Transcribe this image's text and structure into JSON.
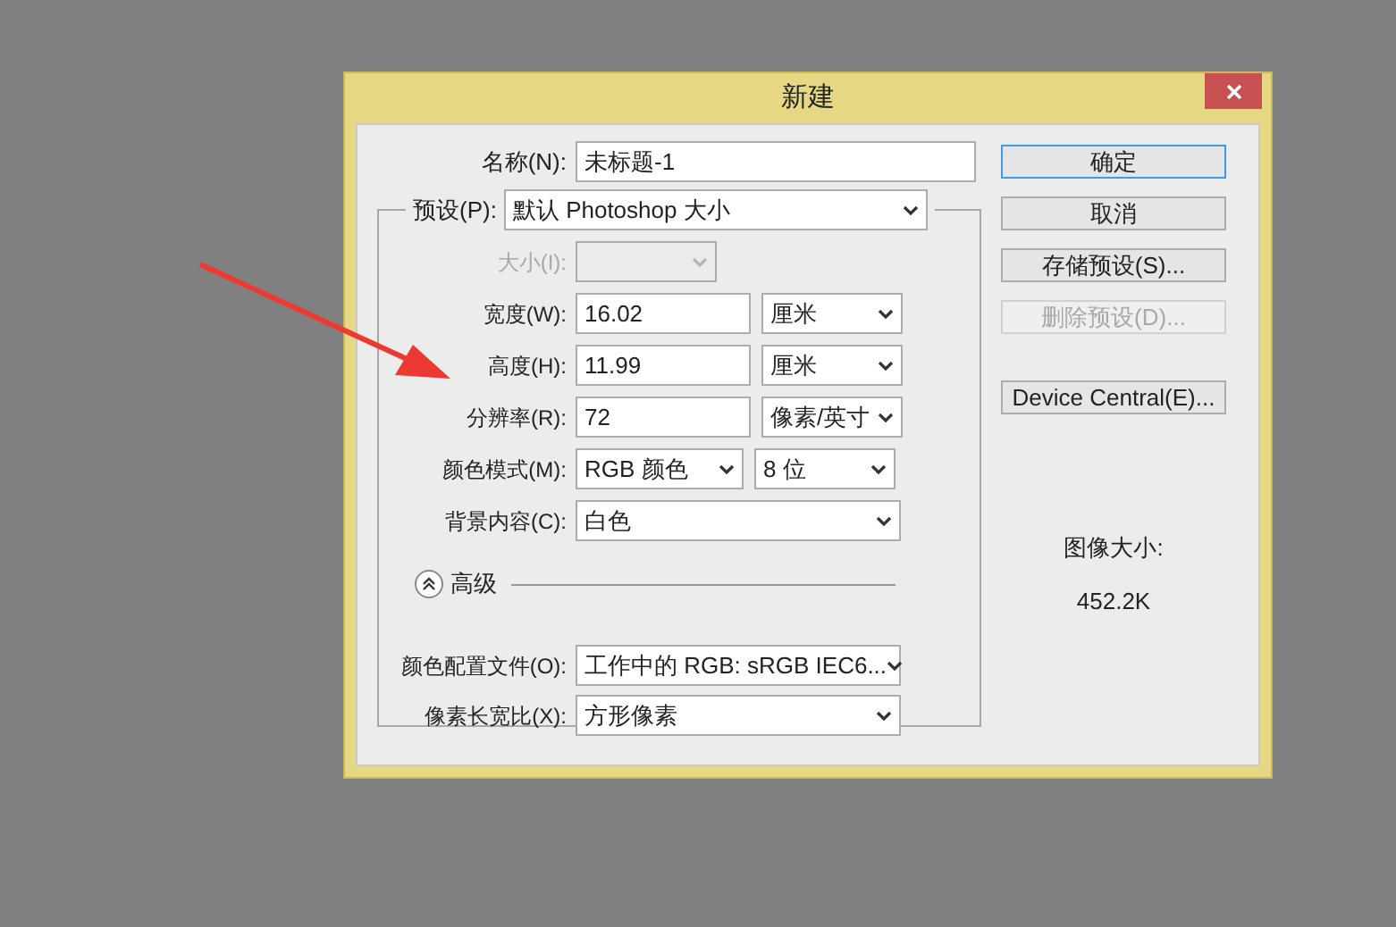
{
  "window": {
    "title": "新建"
  },
  "name": {
    "label": "名称(N):",
    "value": "未标题-1"
  },
  "preset": {
    "label": "预设(P):",
    "value": "默认 Photoshop 大小"
  },
  "rows": [
    {
      "label": "大小(I):",
      "disabled": true,
      "controls": [
        {
          "kind": "select"
        }
      ]
    },
    {
      "label": "宽度(W):",
      "disabled": false,
      "controls": [
        {
          "kind": "input",
          "value": "16.02"
        },
        {
          "kind": "select",
          "value": "厘米"
        }
      ]
    },
    {
      "label": "高度(H):",
      "disabled": false,
      "controls": [
        {
          "kind": "input",
          "value": "11.99"
        },
        {
          "kind": "select",
          "value": "厘米"
        }
      ]
    },
    {
      "label": "分辨率(R):",
      "disabled": false,
      "controls": [
        {
          "kind": "input",
          "value": "72"
        },
        {
          "kind": "select",
          "value": "像素/英寸"
        }
      ]
    },
    {
      "label": "颜色模式(M):",
      "disabled": false,
      "controls": [
        {
          "kind": "select-narrow",
          "value": "RGB 颜色"
        },
        {
          "kind": "select",
          "value": "8 位"
        }
      ]
    },
    {
      "label": "背景内容(C):",
      "disabled": false,
      "controls": [
        {
          "kind": "select-wide",
          "value": "白色"
        }
      ]
    }
  ],
  "advanced": {
    "label": "高级",
    "expanded": true,
    "rows": [
      {
        "label": "颜色配置文件(O):",
        "disabled": false,
        "controls": [
          {
            "kind": "select-wide",
            "value": "工作中的 RGB: sRGB IEC6..."
          }
        ]
      },
      {
        "label": "像素长宽比(X):",
        "disabled": false,
        "controls": [
          {
            "kind": "select-wide",
            "value": "方形像素"
          }
        ]
      }
    ]
  },
  "buttons": [
    {
      "label": "确定",
      "default": true,
      "disabled": false
    },
    {
      "label": "取消",
      "default": false,
      "disabled": false
    },
    {
      "label": "存储预设(S)...",
      "default": false,
      "disabled": false
    },
    {
      "label": "删除预设(D)...",
      "default": false,
      "disabled": true
    },
    {
      "label": "Device Central(E)...",
      "default": false,
      "disabled": false
    }
  ],
  "image_size": {
    "label": "图像大小:",
    "value": "452.2K"
  }
}
